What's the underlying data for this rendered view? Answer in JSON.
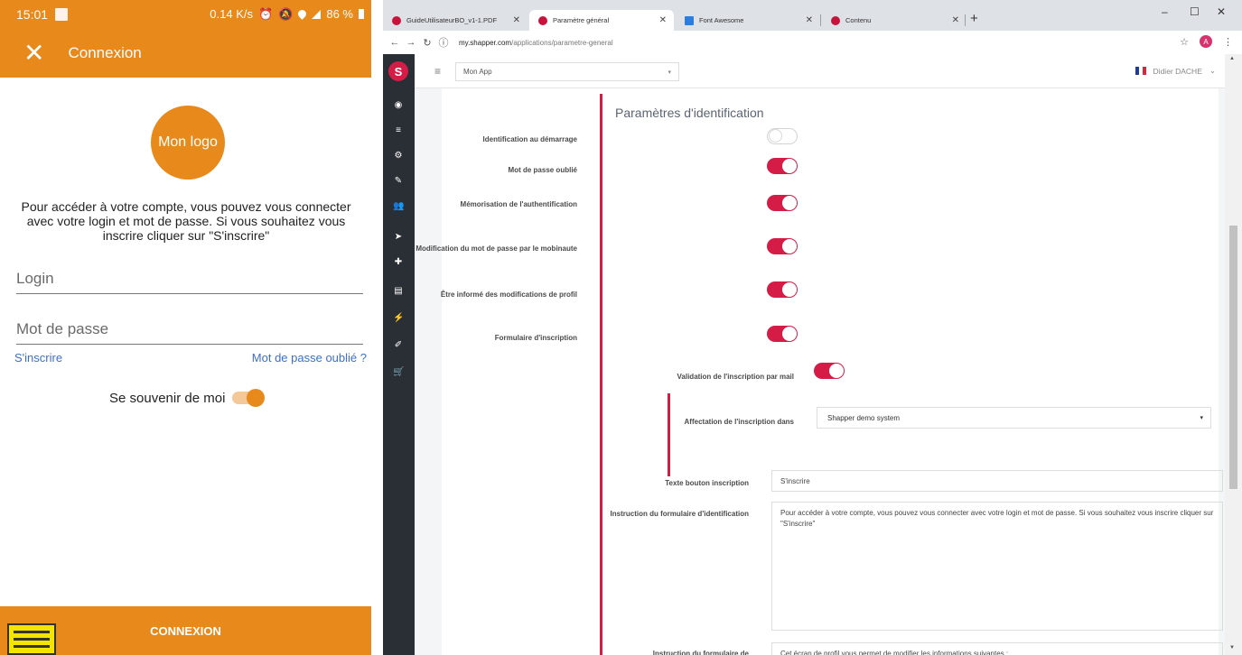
{
  "phone": {
    "status": {
      "time": "15:01",
      "speed": "0.14 K/s",
      "battery": "86 %"
    },
    "app_bar": {
      "title": "Connexion",
      "close_icon": "close-icon"
    },
    "logo_text": "Mon logo",
    "intro": "Pour accéder à votre compte, vous pouvez vous connecter avec votre login et mot de passe. Si vous souhaitez vous inscrire cliquer sur \"S'inscrire\"",
    "login_placeholder": "Login",
    "password_placeholder": "Mot de passe",
    "register_link": "S'inscrire",
    "forgot_link": "Mot de passe oublié ?",
    "remember_label": "Se souvenir de moi",
    "remember_on": true,
    "connect_button": "CONNEXION"
  },
  "browser": {
    "tabs": [
      {
        "label": "GuideUtilisateurBO_v1-1.PDF",
        "icon": "pdf-icon"
      },
      {
        "label": "Paramètre général",
        "icon": "shapper-icon"
      },
      {
        "label": "Font Awesome",
        "icon": "font-awesome-icon"
      },
      {
        "label": "Contenu",
        "icon": "shapper-icon"
      }
    ],
    "url_host": "my.shapper.com",
    "url_path": "/applications/parametre-general",
    "avatar_letter": "A"
  },
  "admin": {
    "sidebar_logo": "S",
    "app_selector": "Mon App",
    "user_name": "Didier DACHE",
    "section_title": "Paramètres d'identification",
    "settings": [
      {
        "label": "Identification au démarrage",
        "enabled": false
      },
      {
        "label": "Mot de passe oublié",
        "enabled": true
      },
      {
        "label": "Mémorisation de l'authentification",
        "enabled": true
      },
      {
        "label": "Modification du mot de passe par le mobinaute",
        "enabled": true
      },
      {
        "label": "Être informé des modifications de profil",
        "enabled": true
      },
      {
        "label": "Formulaire d'inscription",
        "enabled": true
      }
    ],
    "sub_settings": {
      "validation_label": "Validation de l'inscription par mail",
      "validation_enabled": true,
      "affectation_label": "Affectation de l'inscription dans",
      "affectation_value": "Shapper demo system"
    },
    "register_button_label": "Texte bouton inscription",
    "register_button_value": "S'inscrire",
    "form_instruction_label": "Instruction du formulaire d'identification",
    "form_instruction_value": "Pour accéder à votre compte, vous pouvez vous connecter avec votre login et mot de passe. Si vous souhaitez vous inscrire cliquer sur \"S'inscrire\"",
    "profile_instruction_label": "Instruction du formulaire de",
    "profile_instruction_value": "Cet écran de profil vous permet de modifier les informations suivantes :"
  },
  "colors": {
    "phone_accent": "#e8891c",
    "admin_accent": "#d41c46",
    "sidebar": "#2a2f35"
  }
}
